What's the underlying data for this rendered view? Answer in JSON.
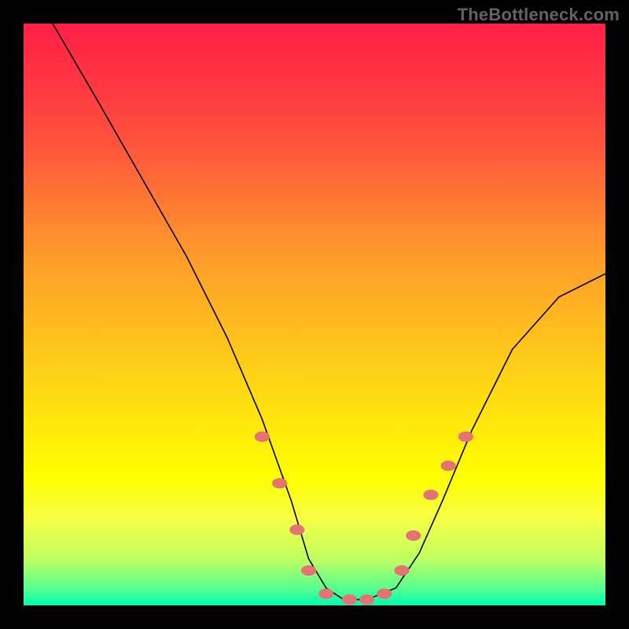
{
  "watermark": "TheBottleneck.com",
  "chart_data": {
    "type": "line",
    "title": "",
    "xlabel": "",
    "ylabel": "",
    "xlim": [
      0,
      100
    ],
    "ylim": [
      0,
      100
    ],
    "background_gradient_stops": [
      {
        "offset": 0.0,
        "color": "#ff1f47"
      },
      {
        "offset": 0.18,
        "color": "#ff4a3e"
      },
      {
        "offset": 0.4,
        "color": "#ff9b2b"
      },
      {
        "offset": 0.6,
        "color": "#ffd117"
      },
      {
        "offset": 0.78,
        "color": "#ffff00"
      },
      {
        "offset": 0.85,
        "color": "#f7ff45"
      },
      {
        "offset": 0.92,
        "color": "#bfff60"
      },
      {
        "offset": 0.97,
        "color": "#59ff8f"
      },
      {
        "offset": 1.0,
        "color": "#00ffb0"
      }
    ],
    "series": [
      {
        "name": "curve",
        "color": "#000000",
        "x": [
          5,
          12,
          20,
          28,
          35,
          41,
          46,
          49,
          52,
          55,
          59,
          64,
          68,
          72,
          77,
          84,
          92,
          100
        ],
        "y": [
          100,
          88,
          74,
          60,
          46,
          32,
          18,
          8,
          3,
          1,
          1,
          3,
          9,
          18,
          30,
          44,
          53,
          57
        ]
      }
    ],
    "dot_series": {
      "name": "highlight-dots",
      "color": "#e57373",
      "x": [
        41,
        44,
        47,
        49,
        52,
        56,
        59,
        62,
        65,
        67,
        70,
        73,
        76
      ],
      "y": [
        29,
        21,
        13,
        6,
        2,
        1,
        1,
        2,
        6,
        12,
        19,
        24,
        29
      ]
    }
  }
}
